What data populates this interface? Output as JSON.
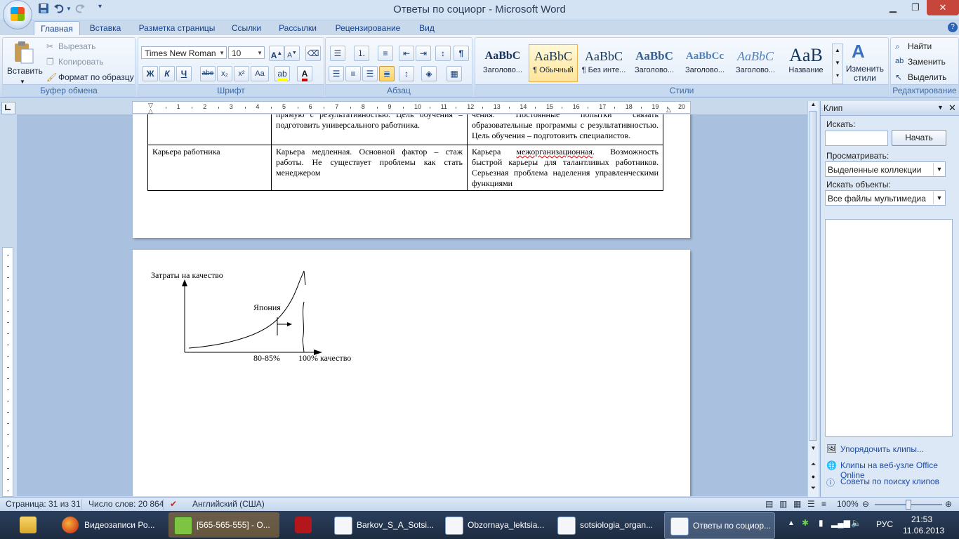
{
  "window": {
    "title": "Ответы по социорг - Microsoft Word"
  },
  "qat": {
    "save_icon": "save-icon",
    "undo_icon": "undo-icon",
    "redo_icon": "redo-icon"
  },
  "tabs": [
    "Главная",
    "Вставка",
    "Разметка страницы",
    "Ссылки",
    "Рассылки",
    "Рецензирование",
    "Вид"
  ],
  "ribbon": {
    "clipboard": {
      "paste": "Вставить",
      "cut": "Вырезать",
      "copy": "Копировать",
      "format_painter": "Формат по образцу",
      "label": "Буфер обмена"
    },
    "font": {
      "name": "Times New Roman",
      "size": "10",
      "label": "Шрифт",
      "aa": "Aa",
      "bold": "Ж",
      "italic": "К",
      "underline": "Ч",
      "strike": "abe",
      "subscript": "x₂",
      "superscript": "x²"
    },
    "paragraph": {
      "label": "Абзац",
      "pilcrow": "¶"
    },
    "styles": {
      "label": "Стили",
      "items": [
        {
          "sample": "AaBbC",
          "name": "Заголово..."
        },
        {
          "sample": "AaBbC",
          "name": "¶ Обычный"
        },
        {
          "sample": "AaBbC",
          "name": "¶ Без инте..."
        },
        {
          "sample": "AaBbC",
          "name": "Заголово..."
        },
        {
          "sample": "AaBbCc",
          "name": "Заголово..."
        },
        {
          "sample": "AaBbC",
          "name": "Заголово..."
        },
        {
          "sample": "AaB",
          "name": "Название"
        }
      ],
      "change": "Изменить стили"
    },
    "editing": {
      "label": "Редактирование",
      "find": "Найти",
      "replace": "Заменить",
      "select": "Выделить"
    }
  },
  "ruler": {
    "numbers": [
      "1",
      "2",
      "3",
      "4",
      "5",
      "6",
      "7",
      "8",
      "9",
      "10",
      "11",
      "12",
      "13",
      "14",
      "15",
      "16",
      "17",
      "18",
      "19",
      "20"
    ]
  },
  "document": {
    "table_top_rows": [
      {
        "c1": "",
        "c2": "прямую с результативностью. Цель обучения – подготовить универсального работника.",
        "c3": "чения. Постоянные попытки связать образовательные программы с результативностью. Цель обучения – подготовить специалистов."
      }
    ],
    "career_row": {
      "c1": "Карьера работника",
      "c2": "Карьера медленная. Основной фактор – стаж работы. Не существует проблемы как стать менеджером",
      "c3_a": "Карьера ",
      "c3_wavy": "межорганизационная",
      "c3_b": ". Возможность быстрой карьеры для талантливых работников. Серьезная проблема наделения управленческими функциями"
    },
    "chart": {
      "ylabel": "Затраты на качество",
      "curve_label": "Япония",
      "x_tick_1": "80-85%",
      "x_tick_2": "100% качество"
    }
  },
  "clipart_pane": {
    "title": "Клип",
    "search_label": "Искать:",
    "search_value": "",
    "go_button": "Начать",
    "browse_label": "Просматривать:",
    "browse_value": "Выделенные коллекции",
    "type_label": "Искать объекты:",
    "type_value": "Все файлы мультимедиа",
    "links": [
      "Упорядочить клипы...",
      "Клипы на веб-узле Office Online",
      "Советы по поиску клипов"
    ]
  },
  "statusbar": {
    "page": "Страница: 31 из 31",
    "words": "Число слов: 20 864",
    "language": "Английский (США)",
    "zoom": "100%"
  },
  "taskbar": {
    "items": [
      "Видеозаписи Ро...",
      "[565-565-555] - О...",
      "",
      "Barkov_S_A_Sotsi...",
      "Obzornaya_lektsia...",
      "sotsiologia_organ...",
      "Ответы по социор..."
    ],
    "lang": "РУС",
    "time": "21:53",
    "date": "11.06.2013"
  }
}
